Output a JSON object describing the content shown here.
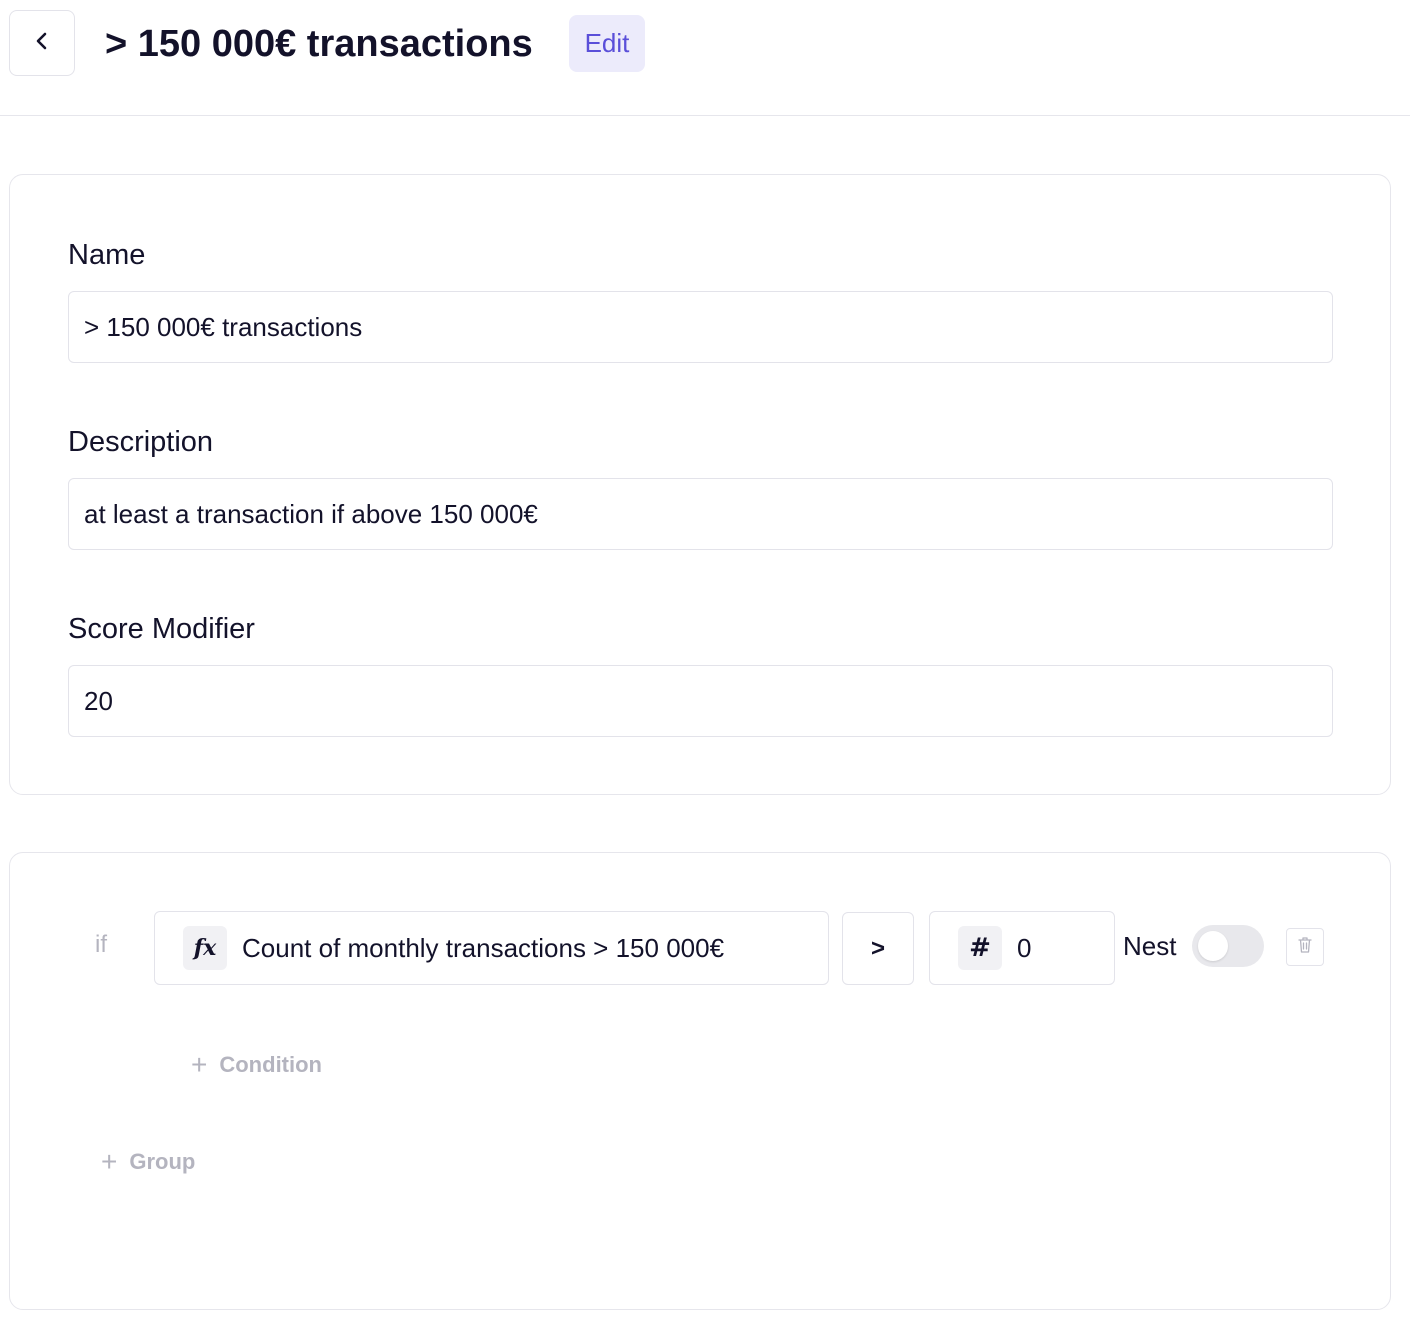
{
  "header": {
    "title": "> 150 000€ transactions",
    "edit_label": "Edit"
  },
  "form": {
    "name_label": "Name",
    "name_value": "> 150 000€ transactions",
    "description_label": "Description",
    "description_value": "at least a transaction if above 150 000€",
    "score_label": "Score Modifier",
    "score_value": "20"
  },
  "rule": {
    "if_label": "if",
    "left_operand_icon": "fx",
    "left_operand_text": "Count of monthly transactions > 150 000€",
    "operator": ">",
    "right_operand_icon": "#",
    "right_operand_value": "0",
    "nest_label": "Nest",
    "nest_enabled": false,
    "add_condition_label": "Condition",
    "add_group_label": "Group"
  },
  "colors": {
    "accent": "#5a4fd9",
    "accent_bg": "#ecebfb",
    "muted_text": "#b4b4bf",
    "border": "#e3e3ea"
  },
  "icons": {
    "back": "chevron-left-icon",
    "function": "function-icon",
    "number": "hash-icon",
    "delete": "trash-icon",
    "add": "plus-icon"
  }
}
